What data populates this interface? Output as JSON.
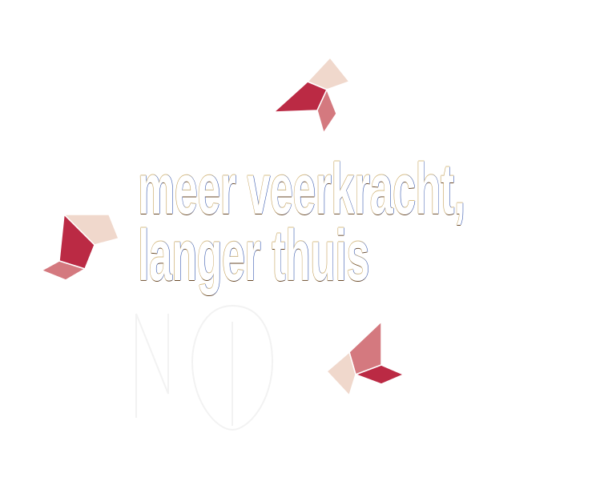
{
  "headline": {
    "line1": "meer veerkracht,",
    "line2": "langer thuis"
  },
  "colors": {
    "crimson": "#bb2a44",
    "rose": "#d4797f",
    "blush": "#f0d8cc",
    "background": "#ffffff"
  },
  "icons": {
    "top": "origami-bird-icon",
    "left": "origami-bird-icon",
    "right": "origami-bird-icon",
    "mark": "logo-mark-icon"
  }
}
